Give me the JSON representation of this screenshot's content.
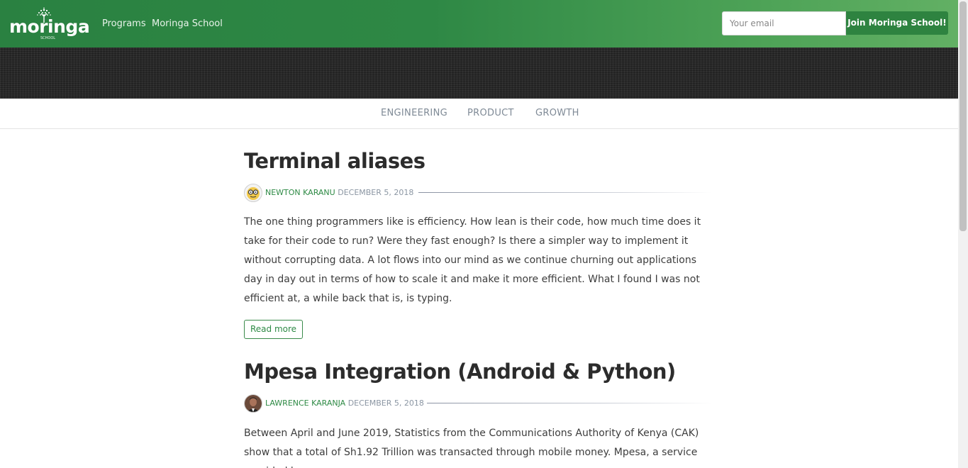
{
  "header": {
    "logo_text": "moringa",
    "logo_sub": "SCHOOL",
    "nav": [
      {
        "label": "Programs"
      },
      {
        "label": "Moringa School"
      }
    ],
    "email_placeholder": "Your email",
    "join_label": "Join Moringa School!"
  },
  "categories": [
    {
      "label": "ENGINEERING"
    },
    {
      "label": "PRODUCT"
    },
    {
      "label": "GROWTH"
    }
  ],
  "posts": [
    {
      "title": "Terminal aliases",
      "author": "NEWTON KARANU",
      "date": "DECEMBER 5, 2018",
      "excerpt": "The one thing programmers like is efficiency. How lean is their code, how much time does it take for their code to run? Were they fast enough? Is there a simpler way to implement it without corrupting data. A lot flows into our mind as we continue churning out applications day in day out in terms of how to scale it and make it more efficient. What I found I was not efficient at, a while back that is, is typing.",
      "read_more": "Read more"
    },
    {
      "title": "Mpesa Integration (Android & Python)",
      "author": "LAWRENCE KARANJA",
      "date": "DECEMBER 5, 2018",
      "excerpt": "Between April and June 2019, Statistics from the Communications Authority of Kenya (CAK) show that a total of Sh1.92 Trillion was transacted through mobile money. Mpesa, a service provided by"
    }
  ],
  "colors": {
    "brand_green": "#2e8340",
    "author_green": "#2e8a45",
    "date_grey": "#8b96a3"
  }
}
